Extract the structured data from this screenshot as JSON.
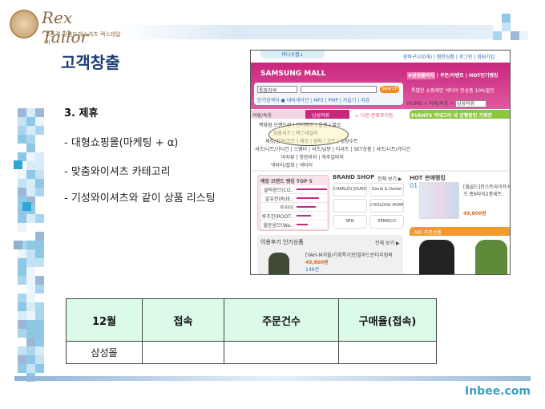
{
  "logo": {
    "name": "Rex Tailor",
    "subtitle": "고품격 맞춤드레스셔츠 렉스테일러"
  },
  "title": "고객창출",
  "section": "3. 제휴",
  "bullets": [
    "- 대형쇼핑몰(마케팅 + α)",
    "- 맞춤와이셔츠 카테고리",
    "- 기성와이셔츠와 같이 상품 리스팅"
  ],
  "mall": {
    "tab": "미니수첩↓",
    "toplinks": "장바구니(0개) | 찜한상품 | 로그인 | 회원가입",
    "brand": "SAMSUNG MALL",
    "nav": [
      "#삼성몰리지",
      "쿠폰/이벤트",
      "HOT인기랭킹"
    ],
    "search_select": "통합검색",
    "search_button": "Search",
    "promo": "특별한 쇼핑제안 넥타이 전상품 10%할인",
    "popular": "인기검색어 ● 네비게이션 | MP3 | PMP | 가습기 | 지갑",
    "breadcrumb": "HOME > 의류/속옷 >",
    "breadcrumb_select": "남성의류",
    "cat_tab1": "의류/속옷",
    "cat_tab2": "남성의류",
    "other": "← 다른 분류로이동",
    "events": "EVENTS 카테고리 내 진행중인 기획전",
    "categories": [
      "백화점 브랜드관 | 인터메조 | 올젠 | 엘모",
      "맞춤셔츠 | 렉스테일러",
      "재킷/점퍼/코트 | 재킷 | 점퍼 | 코트 | 정장수트",
      "셔츠/니트/가디건 | 스웨터 | 셔츠/남방 | 티셔츠 | SET상품 | 셔츠/니트/가디건",
      "바지류 | 정장바지 | 캐주얼바지",
      "넥타이/잡화 | 넥타이"
    ],
    "rank_title": "매장 브랜드 랭킹 TOP 5",
    "ranks": [
      "클릭옴므(CO..",
      "알유진(RUE..",
      "트라이",
      "루츠진(ROOT..",
      "윌튼옴므(Wa.."
    ],
    "brandshop": "BRAND SHOP",
    "view_all": "전체 보기 ▶",
    "brands": [
      "CHARLES JOURDAN",
      "David & Daniel",
      "",
      "COOLDOG HOMME",
      "NFN",
      "ZENRICO"
    ],
    "hot": "HOT 판매랭킹",
    "hot_no": "01",
    "hot_item": "[월골드]진스트라이프셔츠 종6타이2종세트",
    "hot_price": "49,800원",
    "md": "MD 추천상품",
    "review": "이용후기 인기상품",
    "review_item": "[YAH-M겨울/기획특가]인발후드빈티지점퍼",
    "review_price": "49,800원",
    "review_count": "149건"
  },
  "table": {
    "headers": [
      "12월",
      "접속",
      "주문건수",
      "구매율(접속)"
    ],
    "rows": [
      [
        "삼성몰",
        "",
        "",
        ""
      ]
    ]
  },
  "footer": "Inbee.com"
}
